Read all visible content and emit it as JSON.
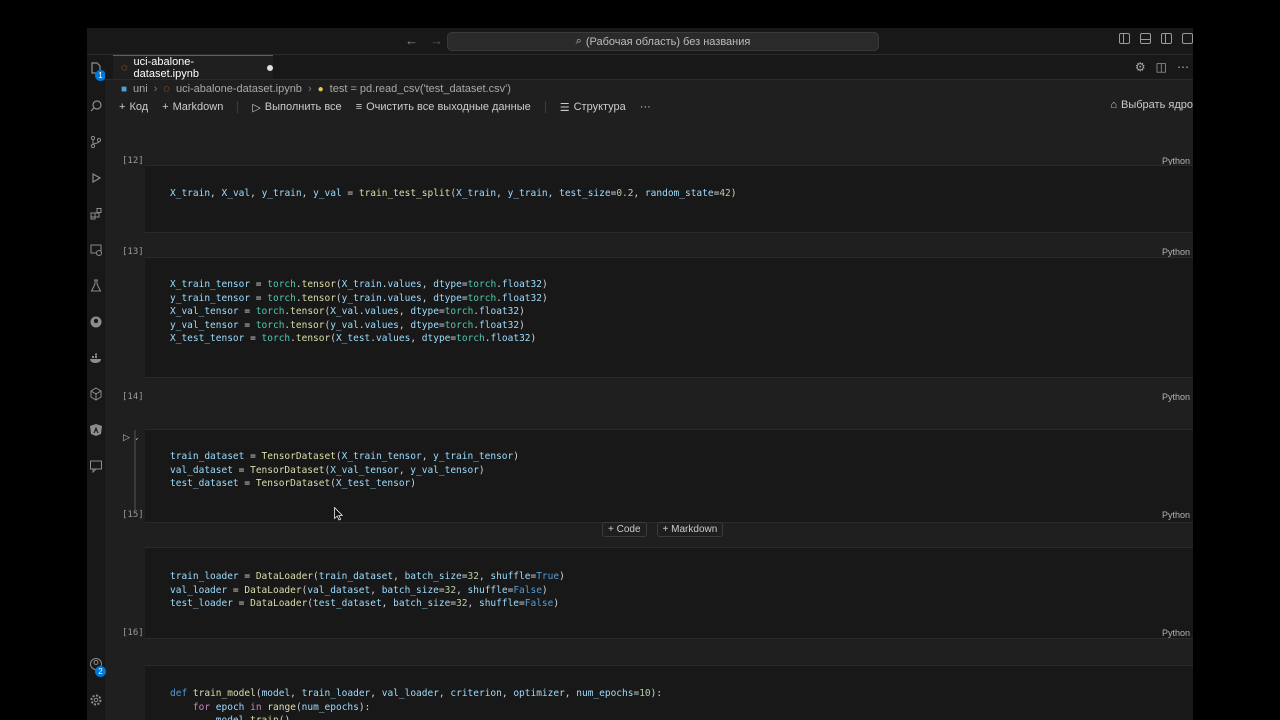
{
  "titlebar": {
    "back": "←",
    "forward": "→",
    "search_icon": "⌕",
    "search_text": "(Рабочая область) без названия"
  },
  "activity": {
    "badge_explorer": "1",
    "badge_accounts": "2"
  },
  "tab": {
    "label": "uci-abalone-dataset.ipynb",
    "icon": "notebook-icon"
  },
  "breadcrumb": {
    "folder": "uni",
    "file": "uci-abalone-dataset.ipynb",
    "cell": "test = pd.read_csv('test_dataset.csv')",
    "sep": "›"
  },
  "toolbar": {
    "code": "Код",
    "markdown": "Markdown",
    "run_all": "Выполнить все",
    "clear_all": "Очистить все выходные данные",
    "outline": "Структура",
    "more": "···",
    "kernel": "Выбрать ядро"
  },
  "cells": [
    {
      "exec": "[12]",
      "lang": "Python"
    },
    {
      "exec": "[13]",
      "lang": "Python"
    },
    {
      "exec": "[14]",
      "lang": "Python"
    },
    {
      "exec": "[15]",
      "lang": "Python"
    },
    {
      "exec": "[16]",
      "lang": "Python"
    }
  ],
  "insert": {
    "code": "Code",
    "markdown": "Markdown",
    "plus": "+"
  }
}
